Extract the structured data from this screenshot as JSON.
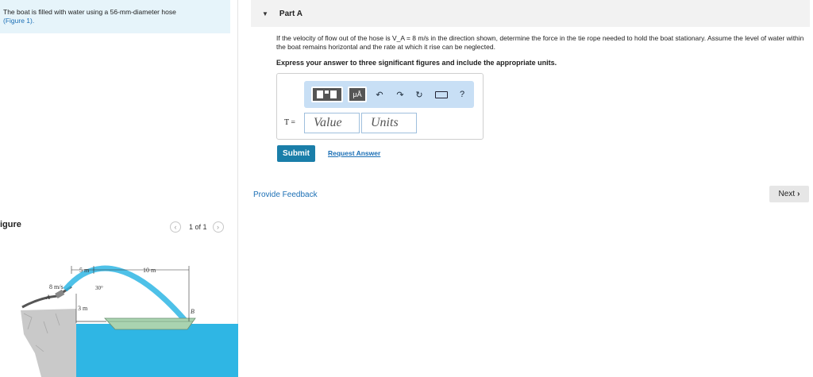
{
  "problem": {
    "statement": "The boat is filled with water using a 56-mm-diameter hose",
    "figure_link": "(Figure 1)."
  },
  "figure_panel": {
    "label": "igure",
    "pager_prev_icon": "chevron-left-icon",
    "pager_next_icon": "chevron-right-icon",
    "pager_text": "1 of 1",
    "diagram_labels": {
      "velocity": "8 m/s",
      "point_a": "A",
      "point_b": "B",
      "dim_5m": "5 m",
      "dim_10m": "10 m",
      "dim_3m": "3 m",
      "angle": "30°"
    },
    "colors": {
      "water": "#2fb6e4",
      "ground": "#c9c9c9",
      "boat": "#a9d3b0"
    }
  },
  "part": {
    "title": "Part A",
    "question": "If the velocity of flow out of the hose is V_A = 8 m/s in the direction shown, determine the force in the tie rope needed to hold the boat stationary. Assume the level of water within the boat remains horizontal and the rate at which it rise can be neglected.",
    "instruction": "Express your answer to three significant figures and include the appropriate units.",
    "toolbar": {
      "template_icon": "template-icon",
      "units_label": "μÅ",
      "undo_icon": "undo-icon",
      "redo_icon": "redo-icon",
      "reset_icon": "reset-icon",
      "keyboard_icon": "keyboard-icon",
      "help_label": "?"
    },
    "answer_label": "T =",
    "value_placeholder": "Value",
    "units_placeholder": "Units",
    "submit_label": "Submit",
    "request_answer_label": "Request Answer"
  },
  "feedback_label": "Provide Feedback",
  "next_label": "Next",
  "accent_color": "#1a7ea9"
}
